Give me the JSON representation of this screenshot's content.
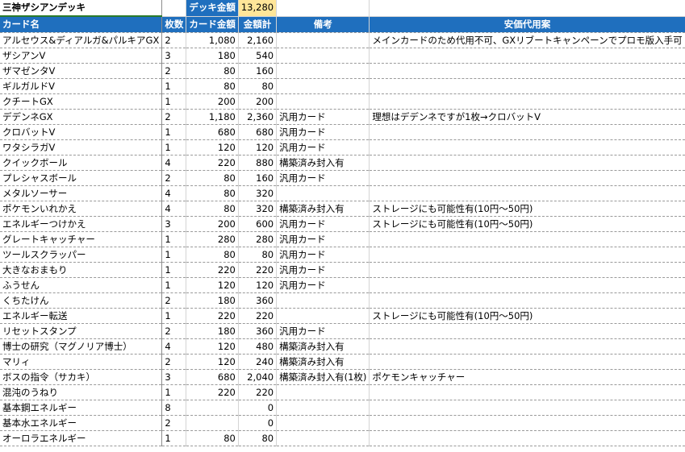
{
  "sheet": {
    "title": "三神ザシアンデッキ",
    "deck_price_label": "デッキ金額",
    "deck_price_value": "13,280"
  },
  "headers": {
    "name": "カード名",
    "qty": "枚数",
    "price": "カード金額",
    "total": "金額計",
    "note": "備考",
    "alt": "安価代用案"
  },
  "rows": [
    {
      "name": "アルセウス&ディアルガ&パルキアGX",
      "qty": "2",
      "price": "1,080",
      "total": "2,160",
      "note": "",
      "alt": "メインカードのため代用不可、GXリブートキャンペーンでプロモ版入手可"
    },
    {
      "name": "ザシアンV",
      "qty": "3",
      "price": "180",
      "total": "540",
      "note": "",
      "alt": ""
    },
    {
      "name": "ザマゼンタV",
      "qty": "2",
      "price": "80",
      "total": "160",
      "note": "",
      "alt": ""
    },
    {
      "name": "ギルガルドV",
      "qty": "1",
      "price": "80",
      "total": "80",
      "note": "",
      "alt": ""
    },
    {
      "name": "クチートGX",
      "qty": "1",
      "price": "200",
      "total": "200",
      "note": "",
      "alt": ""
    },
    {
      "name": "デデンネGX",
      "qty": "2",
      "price": "1,180",
      "total": "2,360",
      "note": "汎用カード",
      "alt": "理想はデデンネですが1枚→クロバットV"
    },
    {
      "name": "クロバットV",
      "qty": "1",
      "price": "680",
      "total": "680",
      "note": "汎用カード",
      "alt": ""
    },
    {
      "name": "ワタシラガV",
      "qty": "1",
      "price": "120",
      "total": "120",
      "note": "汎用カード",
      "alt": ""
    },
    {
      "name": "クイックボール",
      "qty": "4",
      "price": "220",
      "total": "880",
      "note": "構築済み封入有",
      "alt": ""
    },
    {
      "name": "プレシャスボール",
      "qty": "2",
      "price": "80",
      "total": "160",
      "note": "汎用カード",
      "alt": ""
    },
    {
      "name": "メタルソーサー",
      "qty": "4",
      "price": "80",
      "total": "320",
      "note": "",
      "alt": ""
    },
    {
      "name": "ポケモンいれかえ",
      "qty": "4",
      "price": "80",
      "total": "320",
      "note": "構築済み封入有",
      "alt": "ストレージにも可能性有(10円～50円)"
    },
    {
      "name": "エネルギーつけかえ",
      "qty": "3",
      "price": "200",
      "total": "600",
      "note": "汎用カード",
      "alt": "ストレージにも可能性有(10円～50円)"
    },
    {
      "name": "グレートキャッチャー",
      "qty": "1",
      "price": "280",
      "total": "280",
      "note": "汎用カード",
      "alt": ""
    },
    {
      "name": "ツールスクラッパー",
      "qty": "1",
      "price": "80",
      "total": "80",
      "note": "汎用カード",
      "alt": ""
    },
    {
      "name": "大きなおまもり",
      "qty": "1",
      "price": "220",
      "total": "220",
      "note": "汎用カード",
      "alt": ""
    },
    {
      "name": "ふうせん",
      "qty": "1",
      "price": "120",
      "total": "120",
      "note": "汎用カード",
      "alt": ""
    },
    {
      "name": "くちたけん",
      "qty": "2",
      "price": "180",
      "total": "360",
      "note": "",
      "alt": ""
    },
    {
      "name": "エネルギー転送",
      "qty": "1",
      "price": "220",
      "total": "220",
      "note": "",
      "alt": "ストレージにも可能性有(10円～50円)"
    },
    {
      "name": "リセットスタンプ",
      "qty": "2",
      "price": "180",
      "total": "360",
      "note": "汎用カード",
      "alt": ""
    },
    {
      "name": "博士の研究（マグノリア博士）",
      "qty": "4",
      "price": "120",
      "total": "480",
      "note": "構築済み封入有",
      "alt": ""
    },
    {
      "name": "マリィ",
      "qty": "2",
      "price": "120",
      "total": "240",
      "note": "構築済み封入有",
      "alt": ""
    },
    {
      "name": "ボスの指令（サカキ）",
      "qty": "3",
      "price": "680",
      "total": "2,040",
      "note": "構築済み封入有(1枚)",
      "alt": "ポケモンキャッチャー"
    },
    {
      "name": "混沌のうねり",
      "qty": "1",
      "price": "220",
      "total": "220",
      "note": "",
      "alt": ""
    },
    {
      "name": "基本鋼エネルギー",
      "qty": "8",
      "price": "",
      "total": "0",
      "note": "",
      "alt": ""
    },
    {
      "name": "基本水エネルギー",
      "qty": "2",
      "price": "",
      "total": "0",
      "note": "",
      "alt": ""
    },
    {
      "name": "オーロラエネルギー",
      "qty": "1",
      "price": "80",
      "total": "80",
      "note": "",
      "alt": ""
    }
  ]
}
